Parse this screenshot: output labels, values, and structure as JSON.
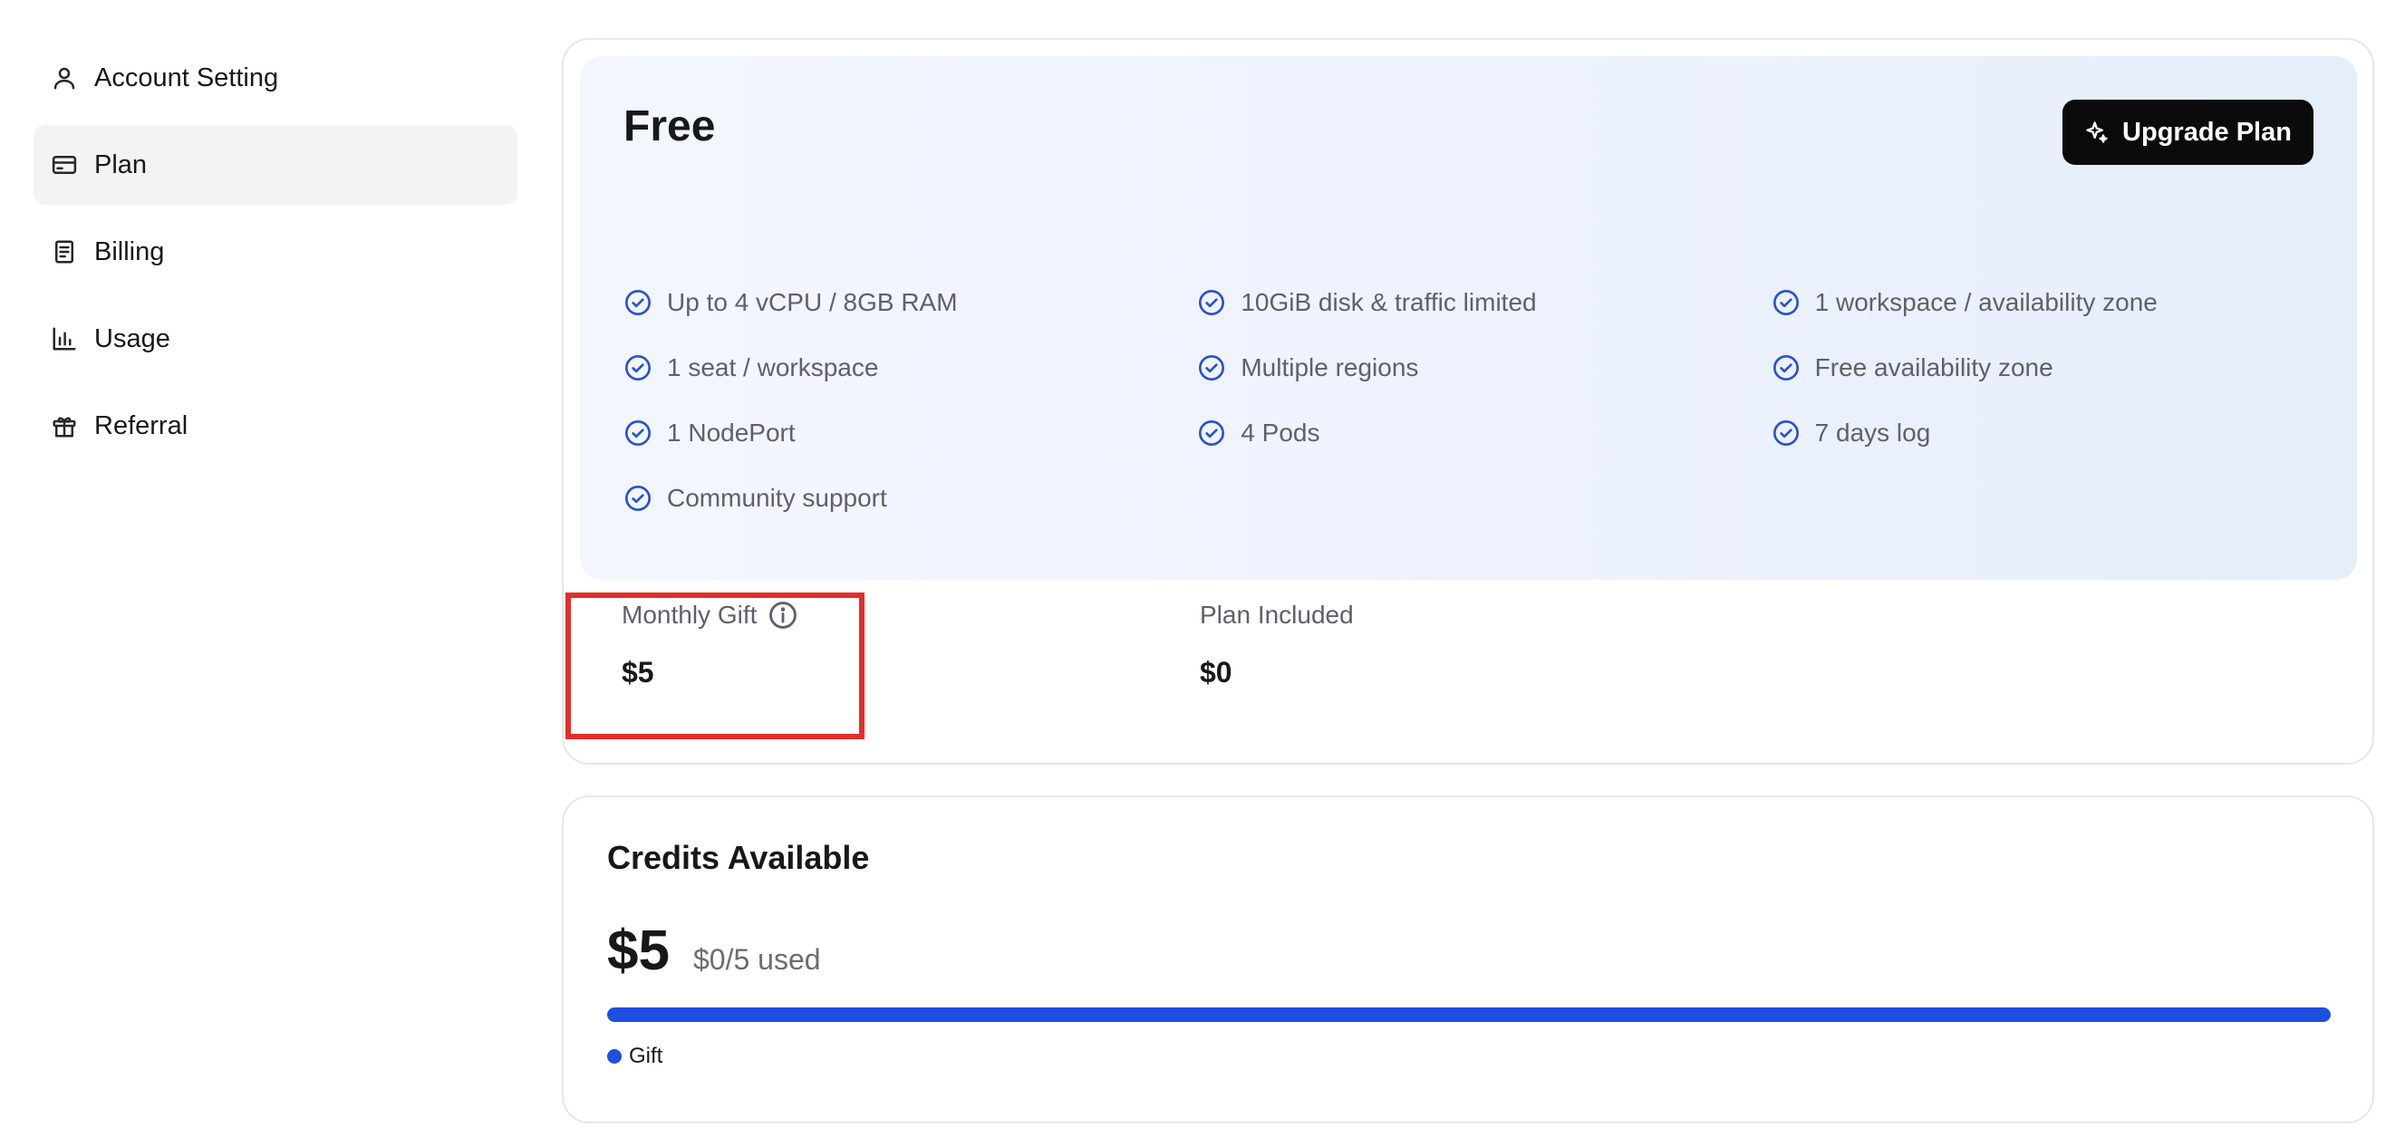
{
  "sidebar": {
    "items": [
      {
        "label": "Account Setting",
        "icon": "user-icon",
        "active": false
      },
      {
        "label": "Plan",
        "icon": "credit-card-icon",
        "active": true
      },
      {
        "label": "Billing",
        "icon": "receipt-icon",
        "active": false
      },
      {
        "label": "Usage",
        "icon": "bar-chart-icon",
        "active": false
      },
      {
        "label": "Referral",
        "icon": "gift-icon",
        "active": false
      }
    ]
  },
  "plan": {
    "name": "Free",
    "upgrade_label": "Upgrade Plan",
    "features": [
      [
        "Up to 4 vCPU / 8GB RAM",
        "10GiB disk & traffic limited",
        "1 workspace / availability zone"
      ],
      [
        "1 seat / workspace",
        "Multiple regions",
        "Free availability zone"
      ],
      [
        "1 NodePort",
        "4 Pods",
        "7 days log"
      ],
      [
        "Community support"
      ]
    ],
    "monthly_gift_label": "Monthly Gift",
    "monthly_gift_value": "$5",
    "plan_included_label": "Plan Included",
    "plan_included_value": "$0"
  },
  "credits": {
    "title": "Credits Available",
    "amount": "$5",
    "used": "$0/5 used",
    "progress_fraction": 1.0,
    "legend": "Gift"
  },
  "colors": {
    "accent": "#1d4fe0",
    "highlight": "#e32f2a"
  }
}
